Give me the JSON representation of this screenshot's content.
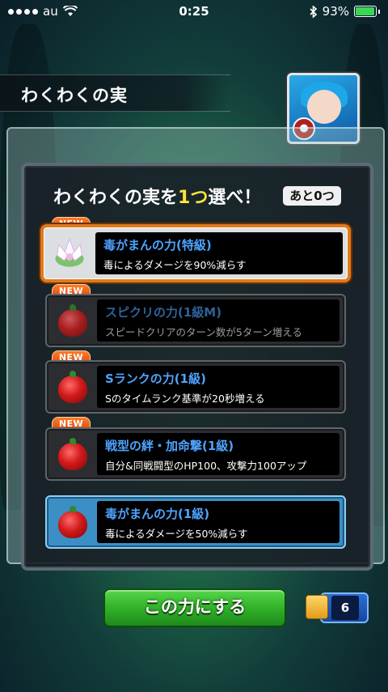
{
  "status_bar": {
    "carrier": "au",
    "time": "0:25",
    "battery": "93%",
    "bluetooth_icon": "bluetooth-icon",
    "wifi_icon": "wifi-icon",
    "battery_level": 0.93
  },
  "title": "わくわくの実",
  "panel": {
    "heading_before": "わくわくの実を",
    "heading_highlight": "1つ",
    "heading_after": "選べ！",
    "remaining": "あと0つ"
  },
  "options": [
    {
      "new": "NEW",
      "name": "毒がまんの力(特級)",
      "desc": "毒によるダメージを90%減らす",
      "icon": "lotus-fruit-icon",
      "state": "selected"
    },
    {
      "new": "NEW",
      "name": "スピクリの力(1級M)",
      "desc": "スピードクリアのターン数が5ターン増える",
      "icon": "red-fruit-icon",
      "state": "dim"
    },
    {
      "new": "NEW",
      "name": "Sランクの力(1級)",
      "desc": "Sのタイムランク基準が20秒増える",
      "icon": "red-fruit-icon",
      "state": "normal"
    },
    {
      "new": "NEW",
      "name": "戦型の絆・加命撃(1級)",
      "desc": "自分&同戦闘型のHP100、攻撃力100アップ",
      "icon": "red-fruit-icon",
      "state": "normal"
    },
    {
      "new": "",
      "name": "毒がまんの力(1級)",
      "desc": "毒によるダメージを50%減らす",
      "icon": "red-fruit-icon",
      "state": "equipped"
    }
  ],
  "confirm_label": "この力にする",
  "counter_value": "6",
  "colors": {
    "accent_orange": "#e07a1b",
    "name_blue": "#4ea3ff",
    "highlight_yellow": "#ffe33a",
    "confirm_green": "#2fae27"
  }
}
